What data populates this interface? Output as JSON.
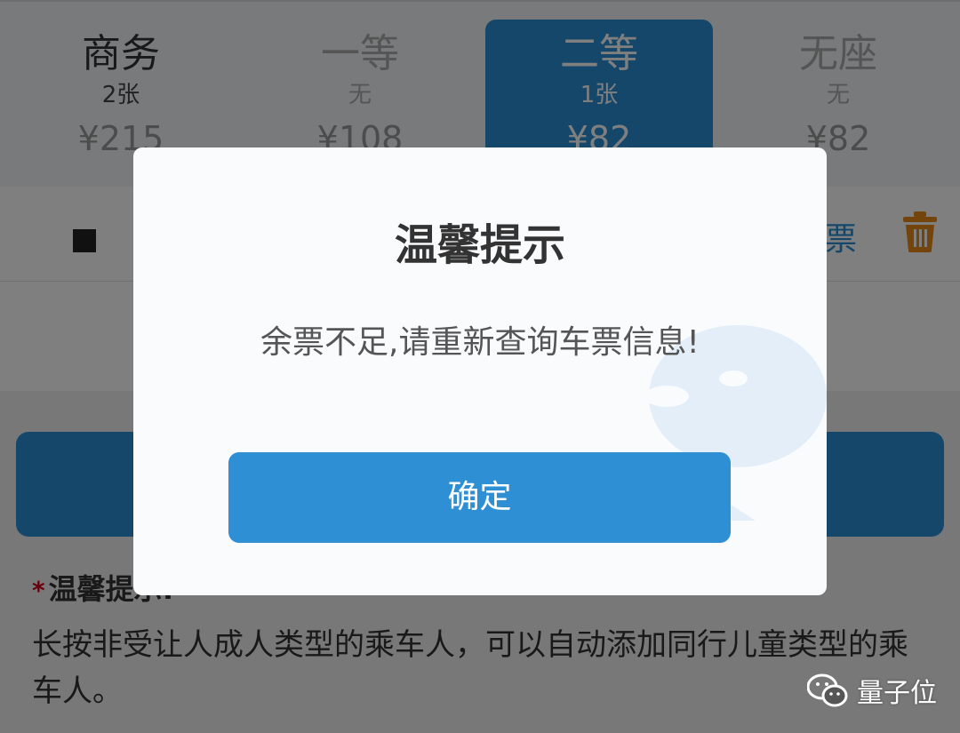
{
  "seats": [
    {
      "name": "商务",
      "count": "2张",
      "price": "¥215"
    },
    {
      "name": "一等",
      "count": "无",
      "price": "¥108"
    },
    {
      "name": "二等",
      "count": "1张",
      "price": "¥82"
    },
    {
      "name": "无座",
      "count": "无",
      "price": "¥82"
    }
  ],
  "passenger": {
    "ticket_type_label": "票"
  },
  "tips": {
    "title": "温馨提示:",
    "body": "长按非受让人成人类型的乘车人，可以自动添加同行儿童类型的乘车人。"
  },
  "dialog": {
    "title": "温馨提示",
    "message": "余票不足,请重新查询车票信息!",
    "confirm_label": "确定"
  },
  "watermark": {
    "text": "量子位"
  },
  "colors": {
    "accent": "#2b8fd6",
    "delete_icon": "#e8891a",
    "required_star": "#d0021b"
  }
}
